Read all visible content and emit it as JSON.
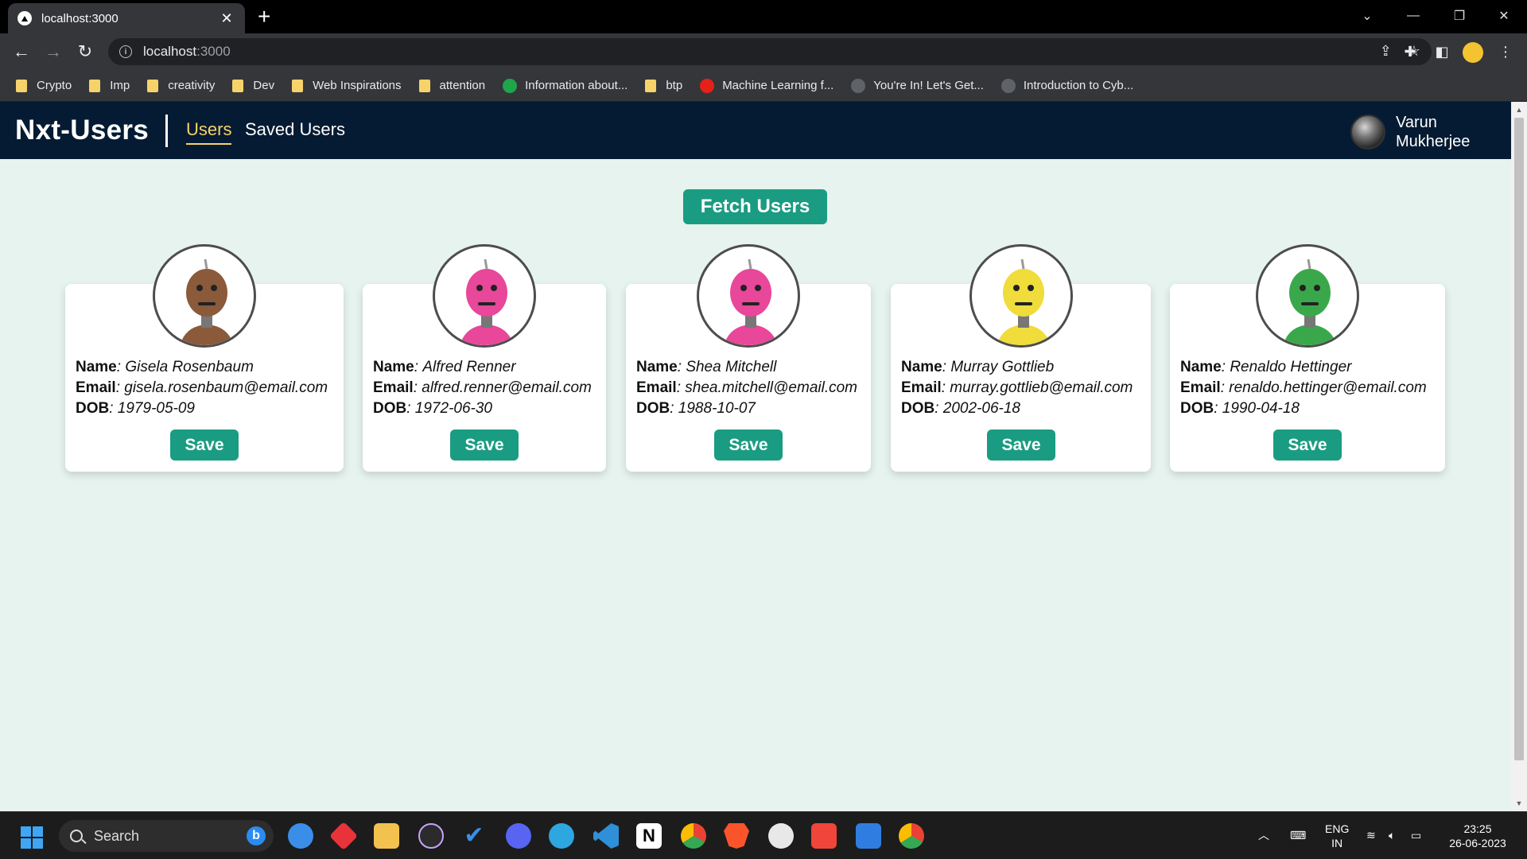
{
  "browser": {
    "tab_title": "localhost:3000",
    "tab_close": "✕",
    "new_tab": "+",
    "url_host": "localhost",
    "url_port": ":3000",
    "bookmarks": [
      {
        "label": "Crypto",
        "icon": "folder-icon"
      },
      {
        "label": "Imp",
        "icon": "folder-icon"
      },
      {
        "label": "creativity",
        "icon": "folder-icon"
      },
      {
        "label": "Dev",
        "icon": "folder-icon"
      },
      {
        "label": "Web Inspirations",
        "icon": "folder-icon"
      },
      {
        "label": "attention",
        "icon": "folder-icon"
      },
      {
        "label": "Information about...",
        "icon": "tv-icon",
        "color": "#1fa64a"
      },
      {
        "label": "btp",
        "icon": "folder-icon"
      },
      {
        "label": "Machine Learning f...",
        "icon": "youtube-icon",
        "color": "#e62117"
      },
      {
        "label": "You're In! Let's Get...",
        "icon": "signature-icon",
        "color": "#9aa0a6"
      },
      {
        "label": "Introduction to Cyb...",
        "icon": "site-icon",
        "color": "#9aa0a6"
      }
    ]
  },
  "app": {
    "logo": "Nxt-Users",
    "nav": [
      {
        "label": "Users",
        "active": true
      },
      {
        "label": "Saved Users",
        "active": false
      }
    ],
    "user_name": "Varun Mukherjee",
    "fetch_button": "Fetch Users",
    "labels": {
      "name": "Name",
      "email": "Email",
      "dob": "DOB",
      "separator": ":"
    },
    "save_label": "Save",
    "users": [
      {
        "name": "Gisela Rosenbaum",
        "email": "gisela.rosenbaum@email.com",
        "dob": "1979-05-09",
        "robot_color": "#8a5a3a"
      },
      {
        "name": "Alfred Renner",
        "email": "alfred.renner@email.com",
        "dob": "1972-06-30",
        "robot_color": "#e8479a"
      },
      {
        "name": "Shea Mitchell",
        "email": "shea.mitchell@email.com",
        "dob": "1988-10-07",
        "robot_color": "#e8479a"
      },
      {
        "name": "Murray Gottlieb",
        "email": "murray.gottlieb@email.com",
        "dob": "2002-06-18",
        "robot_color": "#f0dc3a"
      },
      {
        "name": "Renaldo Hettinger",
        "email": "renaldo.hettinger@email.com",
        "dob": "1990-04-18",
        "robot_color": "#3aa84a"
      }
    ],
    "accent_color": "#1a9c82",
    "nav_bg": "#051b33",
    "page_bg": "#e6f3ee"
  },
  "taskbar": {
    "search_label": "Search",
    "lang_top": "ENG",
    "lang_bottom": "IN",
    "time": "23:25",
    "date": "26-06-2023",
    "apps": [
      "copilot-icon",
      "app-red-icon",
      "file-explorer-icon",
      "media-player-icon",
      "todo-icon",
      "discord-icon",
      "telegram-icon",
      "vscode-icon",
      "notion-icon",
      "chrome-icon",
      "brave-icon",
      "clock-icon",
      "calendar-check-icon",
      "calendar-icon",
      "chrome-canary-icon"
    ]
  }
}
